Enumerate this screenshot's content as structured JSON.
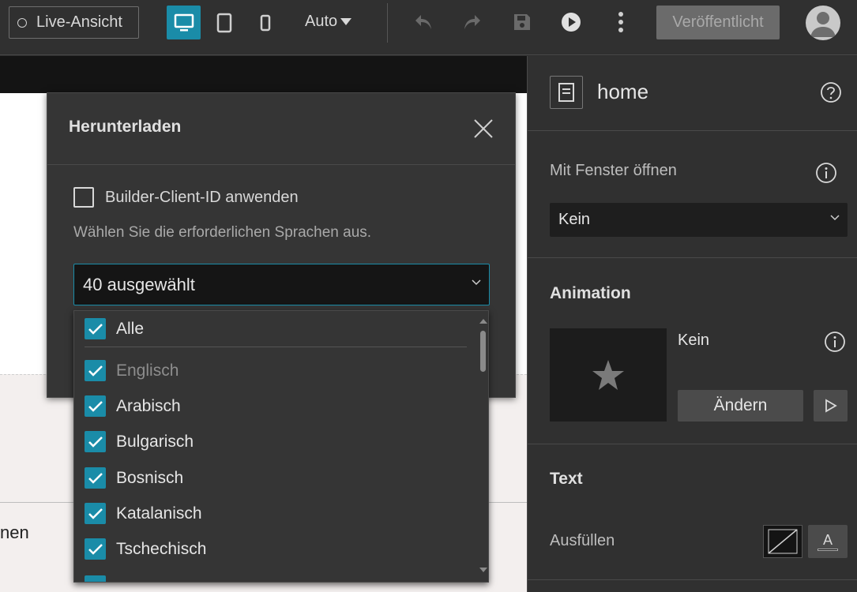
{
  "toolbar": {
    "live_view_label": "Live-Ansicht",
    "screen_size_label": "Auto",
    "publish_label": "Veröffentlicht",
    "accent_color": "#1a8ca8"
  },
  "canvas": {
    "partial_text": "nen"
  },
  "dialog": {
    "title": "Herunterladen",
    "checkbox_label": "Builder-Client-ID anwenden",
    "hint": "Wählen Sie die erforderlichen Sprachen aus.",
    "select_value": "40 ausgewählt",
    "options": [
      {
        "label": "Alle",
        "checked": true
      },
      {
        "label": "Englisch",
        "checked": true,
        "disabled": true
      },
      {
        "label": "Arabisch",
        "checked": true
      },
      {
        "label": "Bulgarisch",
        "checked": true
      },
      {
        "label": "Bosnisch",
        "checked": true
      },
      {
        "label": "Katalanisch",
        "checked": true
      },
      {
        "label": "Tschechisch",
        "checked": true
      }
    ]
  },
  "panel": {
    "page_name": "home",
    "open_window_label": "Mit Fenster öffnen",
    "open_window_value": "Kein",
    "animation_heading": "Animation",
    "animation_value": "Kein",
    "change_label": "Ändern",
    "text_heading": "Text",
    "fill_label": "Ausfüllen",
    "text_color_glyph": "A"
  }
}
